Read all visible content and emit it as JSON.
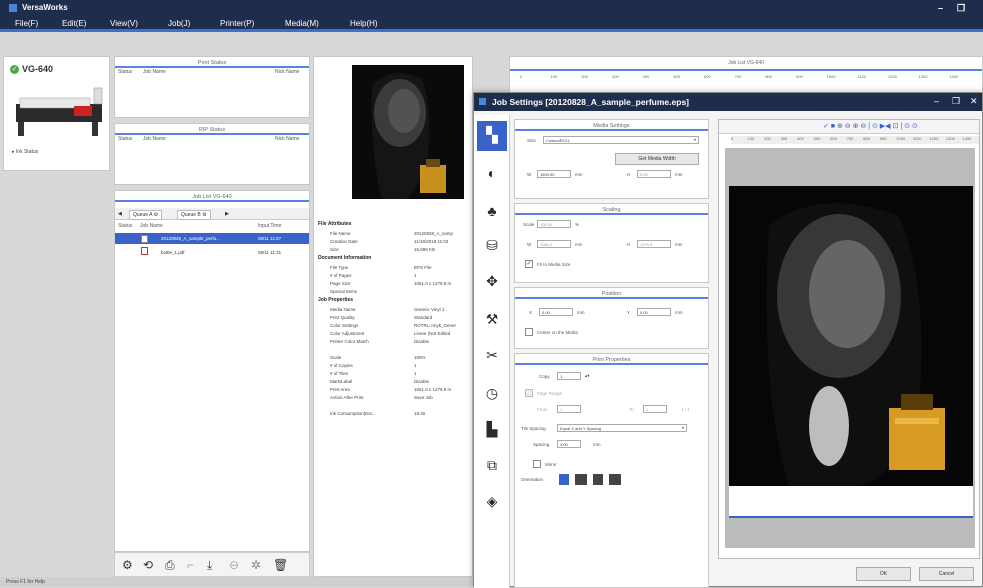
{
  "app": {
    "title": "VersaWorks",
    "minimize": "–",
    "restore": "❐"
  },
  "menu": [
    "File(F)",
    "Edit(E)",
    "View(V)",
    "Job(J)",
    "Printer(P)",
    "Media(M)",
    "Help(H)"
  ],
  "printer": {
    "name": "VG-640",
    "status_link": "Ink Status"
  },
  "print_status": {
    "title": "Print Status",
    "col_status": "Status",
    "col_job": "Job Name",
    "col_nick": "Nick Name"
  },
  "rip_status": {
    "title": "RIP Status",
    "col_status": "Status",
    "col_job": "Job Name",
    "col_nick": "Nick Name"
  },
  "job_list": {
    "title": "Job List VG-640",
    "queue_a": "Queue A",
    "queue_b": "Queue B",
    "col_status": "Status",
    "col_job": "Job Name",
    "col_time": "Input Time",
    "rows": [
      {
        "name": "20120828_A_sample_perfu...",
        "time": "08/11 11:57"
      },
      {
        "name": "bottle_1.pdf",
        "time": "08/11 11:31"
      }
    ]
  },
  "status_bar": "Press F1 for Help",
  "props": {
    "file_attr": "File Attributes",
    "rows1": [
      [
        "File Name",
        "20120828_A_samp"
      ],
      [
        "Creation Date",
        "11/18/2018 11:03"
      ],
      [
        "Size",
        "15,996 KB"
      ]
    ],
    "doc_info": "Document Information",
    "rows2": [
      [
        "File Type",
        "EPS File"
      ],
      [
        "# of Pages",
        "1"
      ],
      [
        "Page Size",
        "1061.0 x 1279.9 m"
      ],
      [
        "Special Items",
        ""
      ]
    ],
    "job_props": "Job Properties",
    "rows3": [
      [
        "Media Name",
        "Generic Vinyl 1"
      ],
      [
        "Print Quality",
        "Standard"
      ],
      [
        "Color Settings",
        "ROTRL:cmyk_Gener"
      ],
      [
        "Color Adjustment",
        "Linear (Not Edited"
      ],
      [
        "Printer Color Match",
        "Disable"
      ],
      [
        "",
        ""
      ],
      [
        "Scale",
        "100%"
      ],
      [
        "# of Copies",
        "1"
      ],
      [
        "# of Tiles",
        "1"
      ],
      [
        "Mark/Label",
        "Disable"
      ],
      [
        "Print Area",
        "1061.0 x 1279.9 m"
      ],
      [
        "Action After Print",
        "Save Job"
      ],
      [
        "",
        ""
      ],
      [
        "Ink Consumption(Est...",
        "18.46"
      ]
    ]
  },
  "right_header": "Job List VG-640",
  "dialog": {
    "title": "Job Settings [20120828_A_sample_perfume.eps]",
    "min": "–",
    "max": "❐",
    "close": "✕",
    "media": {
      "title": "Media Settings",
      "size_label": "Size",
      "size_value": "CustomROLL",
      "get_width": "Get Media Width",
      "w_label": "W",
      "w_value": "1600.00",
      "h_label": "H",
      "h_value": "0.00",
      "unit": "mm"
    },
    "scaling": {
      "title": "Scaling",
      "scale_label": "Scale",
      "scale_value": "100.00",
      "pct": "%",
      "w_label": "W",
      "w_value": "1061.0",
      "h_label": "H",
      "h_value": "1279.9",
      "unit": "mm",
      "fit": "Fit to Media Size"
    },
    "position": {
      "title": "Position",
      "x_label": "X",
      "x_value": "0.00",
      "y_label": "Y",
      "y_value": "0.00",
      "unit": "mm",
      "center": "Center on the Media"
    },
    "print_props": {
      "title": "Print Properties",
      "copy_label": "Copy",
      "copy_value": "1",
      "page_range": "Page Range",
      "from_label": "From",
      "from_value": "1",
      "to_label": "To",
      "to_value": "1",
      "of": "1 / 1",
      "tile_label": "Tile Spacing",
      "tile_value": "Equal X and Y Spacing",
      "spacing_label": "Spacing",
      "spacing_value": "4.00",
      "unit": "mm",
      "mirror": "Mirror",
      "orientation": "Orientation"
    },
    "ok": "OK",
    "cancel": "Cancel"
  },
  "ruler": [
    "0",
    "100",
    "200",
    "300",
    "400",
    "500",
    "600",
    "700",
    "800",
    "900",
    "1000",
    "1100",
    "1200",
    "1300",
    "1400"
  ],
  "preview_toolbar": "✓ ■ ⊕ ⊖ ⊕ ⊖ | ⊙ ▶◀ ⊡ | ⊙ ⊙"
}
